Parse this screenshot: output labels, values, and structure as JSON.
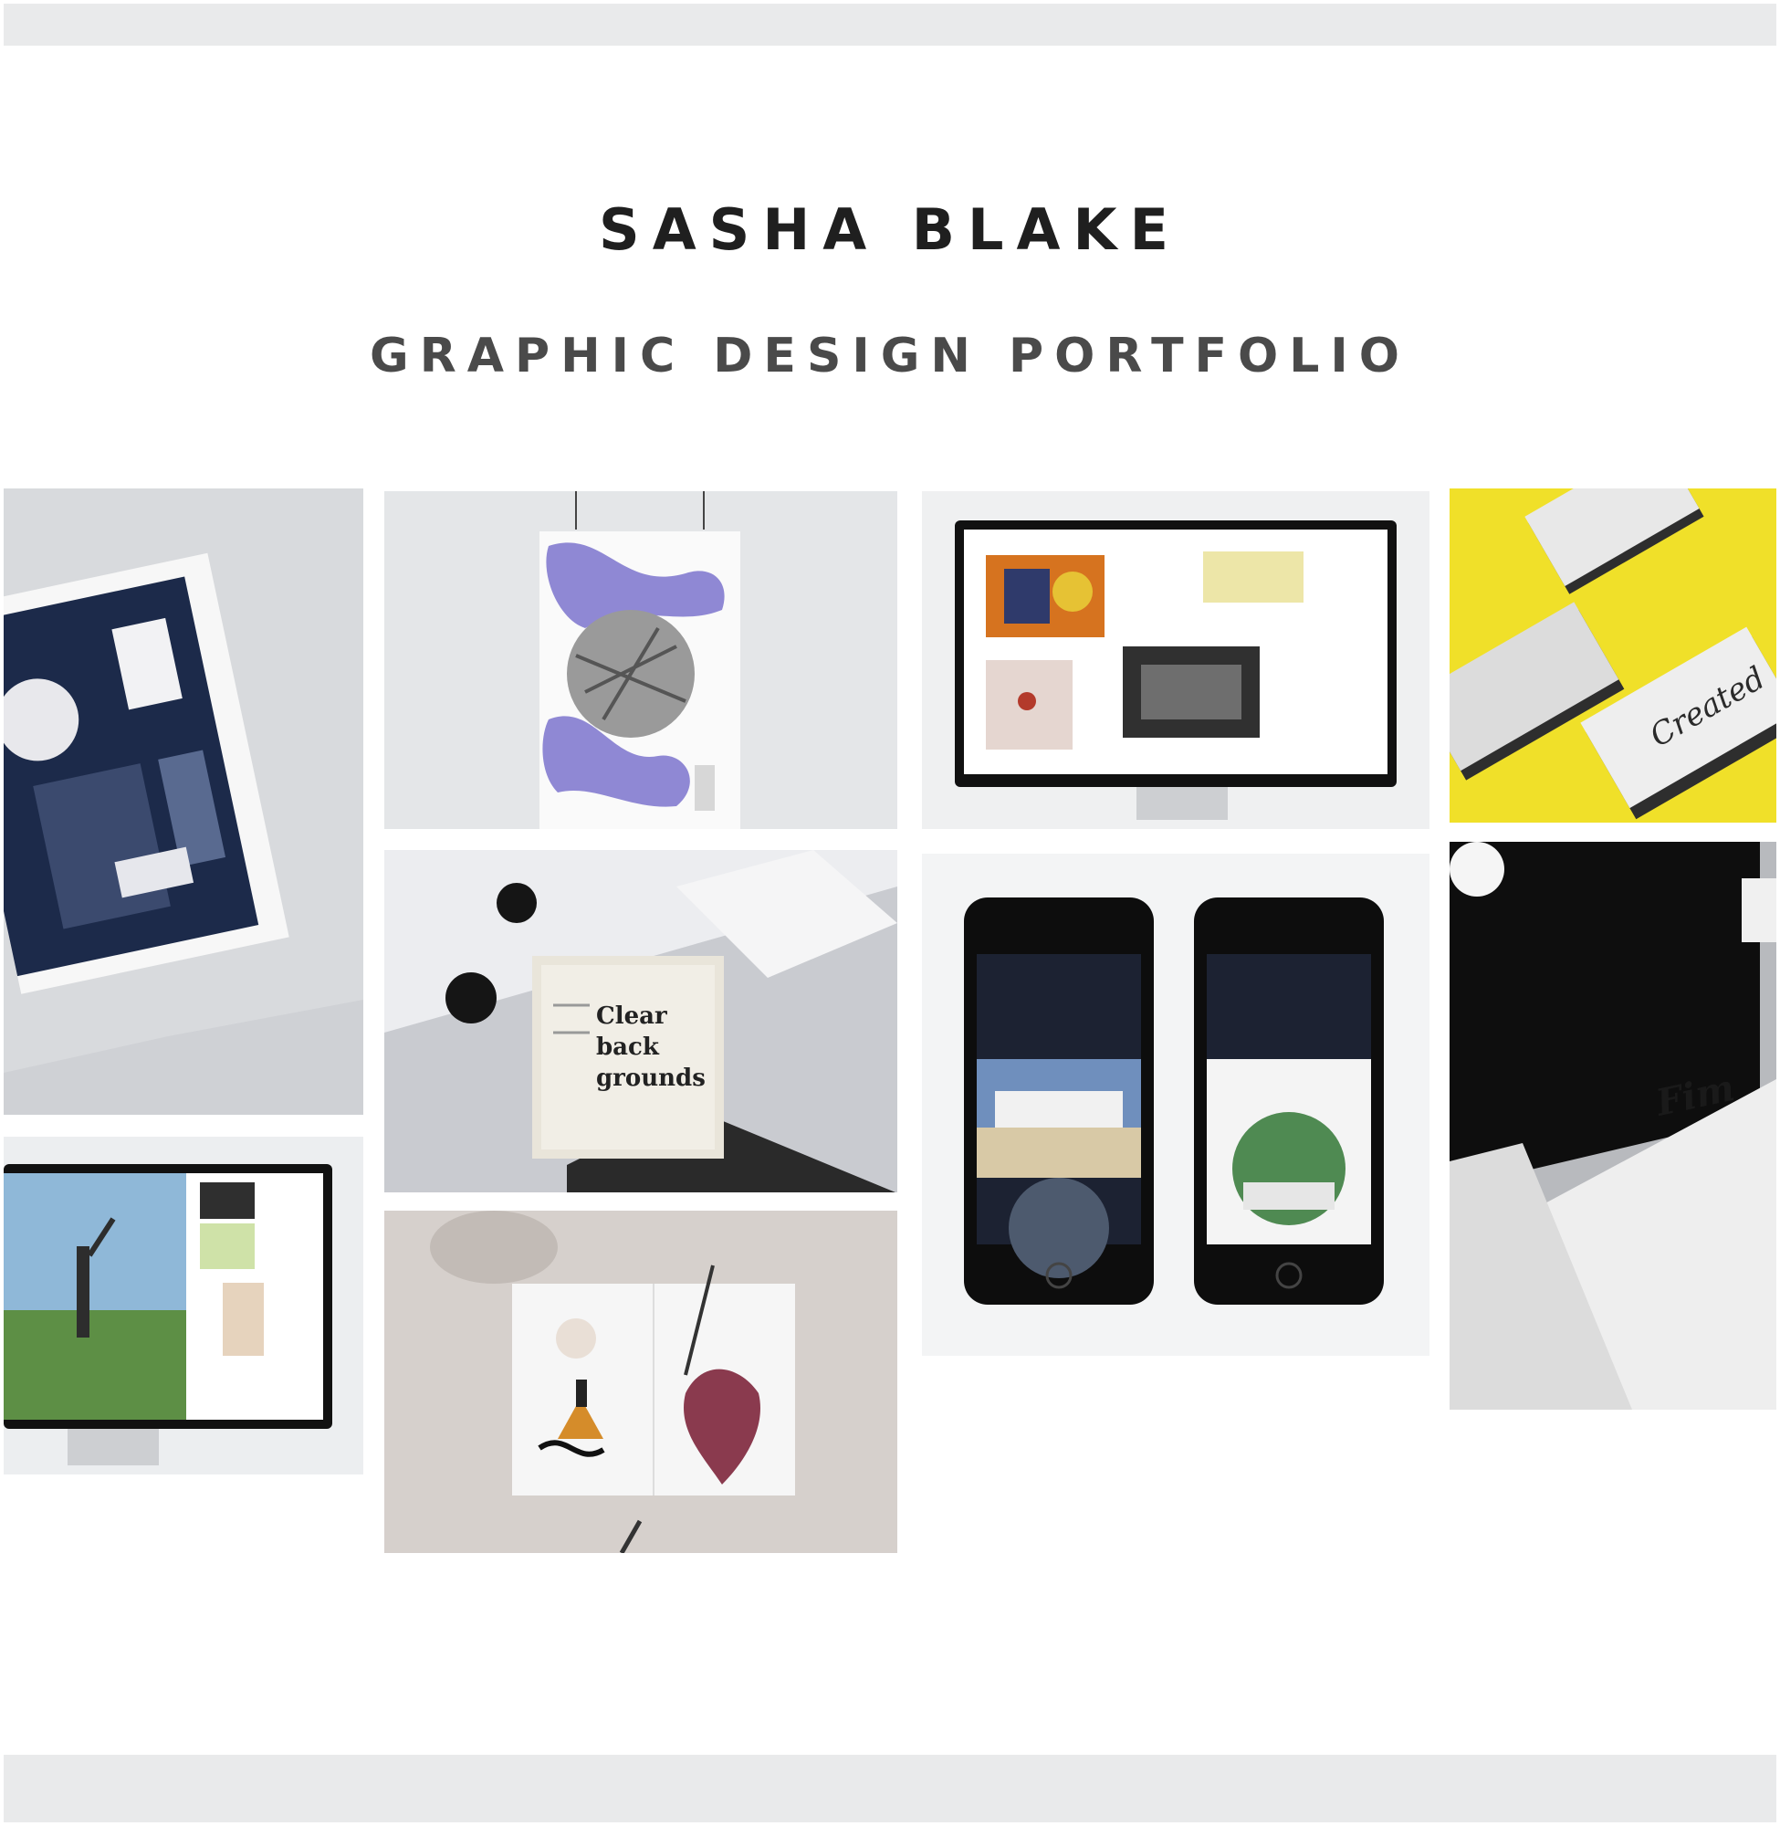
{
  "header": {
    "name": "SASHA BLAKE",
    "subtitle": "GRAPHIC DESIGN PORTFOLIO"
  },
  "colors": {
    "page_background": "#ffffff",
    "header_bar": "#e9eaeb",
    "title_text": "#1f1f1f",
    "subtitle_text": "#4a4a4a",
    "accent_yellow": "#f0e029",
    "navy": "#1c2a4a",
    "lavender": "#8f88d4"
  },
  "gallery": {
    "items": [
      {
        "id": "magazine-spread",
        "icon": "magazine-image"
      },
      {
        "id": "hanging-poster",
        "icon": "poster-image"
      },
      {
        "id": "desktop-website",
        "icon": "monitor-image"
      },
      {
        "id": "business-cards",
        "icon": "business-cards-image"
      },
      {
        "id": "clear-backgrounds-book",
        "icon": "book-image"
      },
      {
        "id": "mobile-app",
        "icon": "phones-image"
      },
      {
        "id": "stationery-set",
        "icon": "stationery-image"
      },
      {
        "id": "sports-website",
        "icon": "monitor-image"
      },
      {
        "id": "illustrated-card",
        "icon": "card-image"
      }
    ],
    "book_cover_text": [
      "Clear",
      "back",
      "grounds"
    ],
    "card_script_text": "Created",
    "stationery_script_text": "Fim"
  }
}
